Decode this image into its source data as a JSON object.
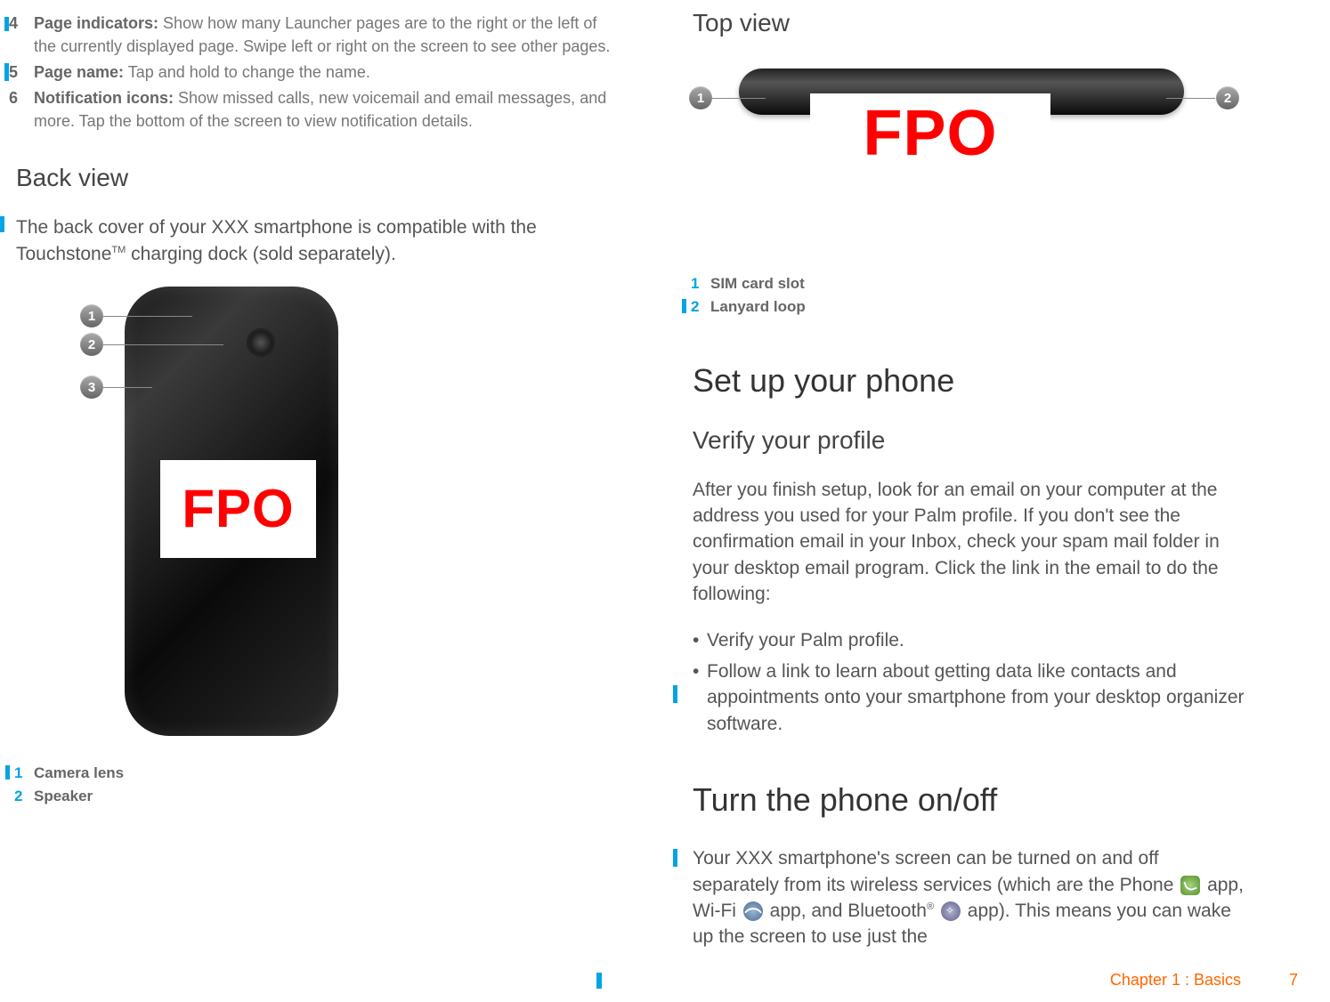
{
  "left": {
    "numbered": [
      {
        "num": "4",
        "term": "Page indicators:",
        "text": " Show how many Launcher pages are to the right or the left of the currently displayed page. Swipe left or right on the screen to see other pages.",
        "mark": "short"
      },
      {
        "num": "5",
        "term": "Page name:",
        "text": " Tap and hold to change the name.",
        "mark": "full"
      },
      {
        "num": "6",
        "term": "Notification icons:",
        "text": " Show missed calls, new voicemail and email messages, and more. Tap the bottom of the screen to view notification details.",
        "mark": "none"
      }
    ],
    "back_heading": "Back view",
    "back_body_1": "The back cover of your XXX smartphone is compatible with the Touchstone",
    "back_body_tm": "TM",
    "back_body_2": " charging dock (sold separately).",
    "fpo": "FPO",
    "callouts_back": [
      {
        "num": "1",
        "label": "Camera lens"
      },
      {
        "num": "2",
        "label": "Speaker"
      }
    ]
  },
  "right": {
    "top_heading": "Top view",
    "fpo": "FPO",
    "callouts_top": [
      {
        "num": "1",
        "label": "SIM card slot"
      },
      {
        "num": "2",
        "label": "Lanyard loop"
      }
    ],
    "setup_heading": "Set up your phone",
    "verify_heading": "Verify your profile",
    "verify_body": "After you finish setup, look for an email on your computer at the address you used for your Palm profile. If you don't see the confirmation email in your Inbox, check your spam mail folder in your desktop email program. Click the link in the email to do the following:",
    "verify_bullets": [
      "Verify your Palm profile.",
      "Follow a link to learn about getting data like contacts and appointments onto your smartphone from your desktop organizer software."
    ],
    "turn_heading": "Turn the phone on/off",
    "turn_body_1": "Your XXX smartphone's screen can be turned on and off separately from its wireless services (which are the Phone ",
    "turn_body_2": " app, Wi-Fi ",
    "turn_body_3": " app, and Bluetooth",
    "turn_body_reg": "®",
    "turn_body_4": " app). This means you can wake up the screen to use just the"
  },
  "footer": {
    "chapter": "Chapter 1 :  Basics",
    "page": "7"
  }
}
